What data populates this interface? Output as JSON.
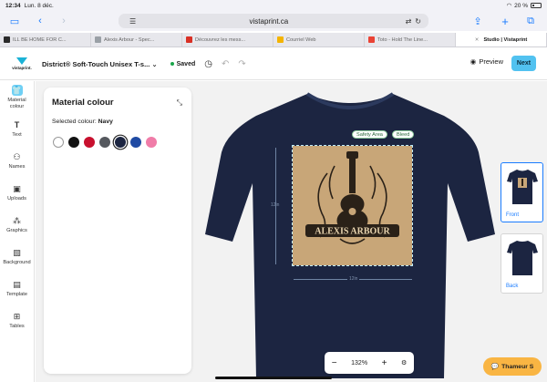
{
  "status": {
    "time": "12:34",
    "date": "Lun. 8 déc.",
    "battery": "20 %"
  },
  "browser": {
    "url": "vistaprint.ca"
  },
  "tabs": [
    {
      "label": "ILL BE HOME FOR C...",
      "color": "#2b2b2b"
    },
    {
      "label": "Alexis Arbour - Spec...",
      "color": "#9aa0a6"
    },
    {
      "label": "Découvrez les mess...",
      "color": "#d93025"
    },
    {
      "label": "Courriel Web",
      "color": "#f4b400"
    },
    {
      "label": "Toto - Hold The Line...",
      "color": "#ea4335"
    },
    {
      "label": "Studio | Vistaprint",
      "color": "#ffffff"
    }
  ],
  "header": {
    "logo_text": "vistaprint.",
    "product_name": "District® Soft-Touch Unisex T-s...",
    "saved_label": "Saved",
    "preview_label": "Preview",
    "next_label": "Next"
  },
  "rail": [
    {
      "label": "Material colour",
      "icon": "tshirt-icon"
    },
    {
      "label": "Text",
      "icon": "text-icon"
    },
    {
      "label": "Names",
      "icon": "people-icon"
    },
    {
      "label": "Uploads",
      "icon": "image-icon"
    },
    {
      "label": "Graphics",
      "icon": "shapes-icon"
    },
    {
      "label": "Background",
      "icon": "background-icon"
    },
    {
      "label": "Template",
      "icon": "template-icon"
    },
    {
      "label": "Tables",
      "icon": "table-icon"
    }
  ],
  "panel": {
    "title": "Material colour",
    "selected_prefix": "Selected colour:",
    "selected_value": "Navy",
    "swatches": [
      {
        "name": "white",
        "hex": "#ffffff"
      },
      {
        "name": "black",
        "hex": "#111111"
      },
      {
        "name": "red",
        "hex": "#c8102e"
      },
      {
        "name": "charcoal",
        "hex": "#55585e"
      },
      {
        "name": "navy",
        "hex": "#1c2541"
      },
      {
        "name": "royal",
        "hex": "#1f4aa3"
      },
      {
        "name": "pink",
        "hex": "#f07ca8"
      }
    ]
  },
  "canvas": {
    "safety_label": "Safety Area",
    "bleed_label": "Bleed",
    "dim_width": "12in",
    "dim_height": "12in",
    "design_text": "ALEXIS ARBOUR",
    "shirt_color": "#1c2541",
    "zoom": "132%"
  },
  "views": [
    {
      "label": "Front"
    },
    {
      "label": "Back"
    }
  ],
  "help": {
    "label": "Thameur S"
  }
}
